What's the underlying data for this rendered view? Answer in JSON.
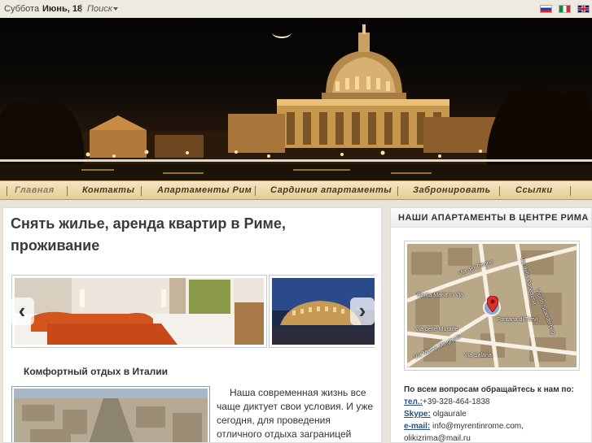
{
  "topbar": {
    "day": "Суббота",
    "date": "Июнь, 18",
    "separator": "|",
    "search_label": "Поиск",
    "languages": [
      "Русский",
      "Italiano",
      "English"
    ]
  },
  "nav": {
    "items": [
      {
        "label": "Главная",
        "active": true
      },
      {
        "label": "Контакты"
      },
      {
        "label": "Апартаменты Рим"
      },
      {
        "label": "Сардиния апартаменты"
      },
      {
        "label": "Забронировать"
      },
      {
        "label": "Ссылки"
      }
    ]
  },
  "main": {
    "title": "Снять жилье, аренда квартир в Риме, проживание",
    "slider": {
      "prev_icon": "‹",
      "next_icon": "›"
    },
    "section_title": "Комфортный отдых в Италии",
    "body_text": "Наша современная жизнь все чаще диктует свои условия. И уже сегодня, для проведения отличного отдыха заграницей совсем необходимо не снимать"
  },
  "sidebar": {
    "title": "НАШИ АПАРТАМЕНТЫ В ЦЕНТРЕ РИМА",
    "map_labels": {
      "tritone": "Via del Tritone",
      "panetteria": "Via della Panetteria",
      "santa_maria": "Santa Maria in Via",
      "fontana": "Fontana di Trevi",
      "sandrone": "Vicolo Scanderbeg",
      "muratte": "Via delle Muratte",
      "minghetti": "Via Marco Minghetti",
      "salaria": "Via Salaria"
    },
    "contact": {
      "question": "По всем вопросам обращайтесь к нам по:",
      "phone_label": "тел.:",
      "phone": "+39-328-464-1838",
      "skype_label": "Skype:",
      "skype": "olgaurale",
      "email_label": "e-mail:",
      "email": "info@myrentinrome.com,",
      "email2": "olikizrima@mail.ru"
    }
  },
  "colors": {
    "nav_bg": "#e2cd96",
    "nav_text": "#4a3a1a",
    "link": "#2a4e8a"
  }
}
